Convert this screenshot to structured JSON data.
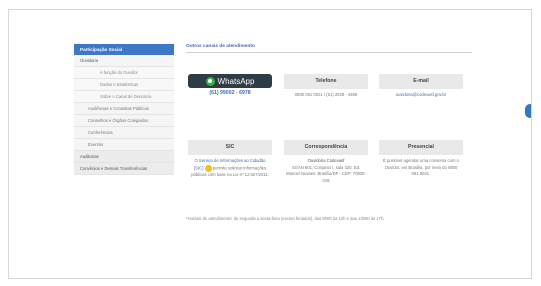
{
  "sidebar": {
    "header": "Participação Social",
    "items": [
      {
        "label": "Ouvidoria",
        "level": "l1"
      },
      {
        "label": "A função do Ouvidor",
        "level": "l3"
      },
      {
        "label": "Dados e Estatísticas",
        "level": "l3"
      },
      {
        "label": "Sobre o Canal de Denúncia",
        "level": "l3"
      },
      {
        "label": "Audiências e Consultas Públicas",
        "level": "l2"
      },
      {
        "label": "Conselhos e Órgãos Colegiados",
        "level": "l2"
      },
      {
        "label": "Conferências",
        "level": "l2"
      },
      {
        "label": "Eventos",
        "level": "l2"
      },
      {
        "label": "Auditorias",
        "level": "top"
      },
      {
        "label": "Convênios e Demais Transferências",
        "level": "top"
      }
    ]
  },
  "main": {
    "title": "Outros canais de atendimento",
    "cards_row1": {
      "whatsapp": {
        "label": "WhatsApp",
        "phone": "(61) 99002 - 6978"
      },
      "telefone": {
        "title": "Telefone",
        "text": "0800 061 0021 / (61) 2028 - 4486"
      },
      "email": {
        "title": "E-mail",
        "text": "ouvidoria@codevasf.gov.br"
      }
    },
    "cards_row2": {
      "sic": {
        "title": "SIC",
        "line1": "O ",
        "link": "Serviço de Informações ao Cidadão (SIC)",
        "line2": " permite solicitar informações públicas com base na Lei nº 12.527/2011."
      },
      "correspondencia": {
        "title": "Correspondência",
        "name": "Ouvidoria Codevasf",
        "text": "SGAN 601, Conjunto I, sala 420. Ed. Manoel Novaes. Brasília/DF - CEP: 70830-019"
      },
      "presencial": {
        "title": "Presencial",
        "text": "É possível agendar uma conversa com o Ouvidor, em Brasília, por meio do 0800 061 0021."
      }
    },
    "footnote": "*Horário de atendimento: de segunda a sexta-feira (exceto feriados), das 8h00 às 12h e das 13h00 às 17h."
  }
}
